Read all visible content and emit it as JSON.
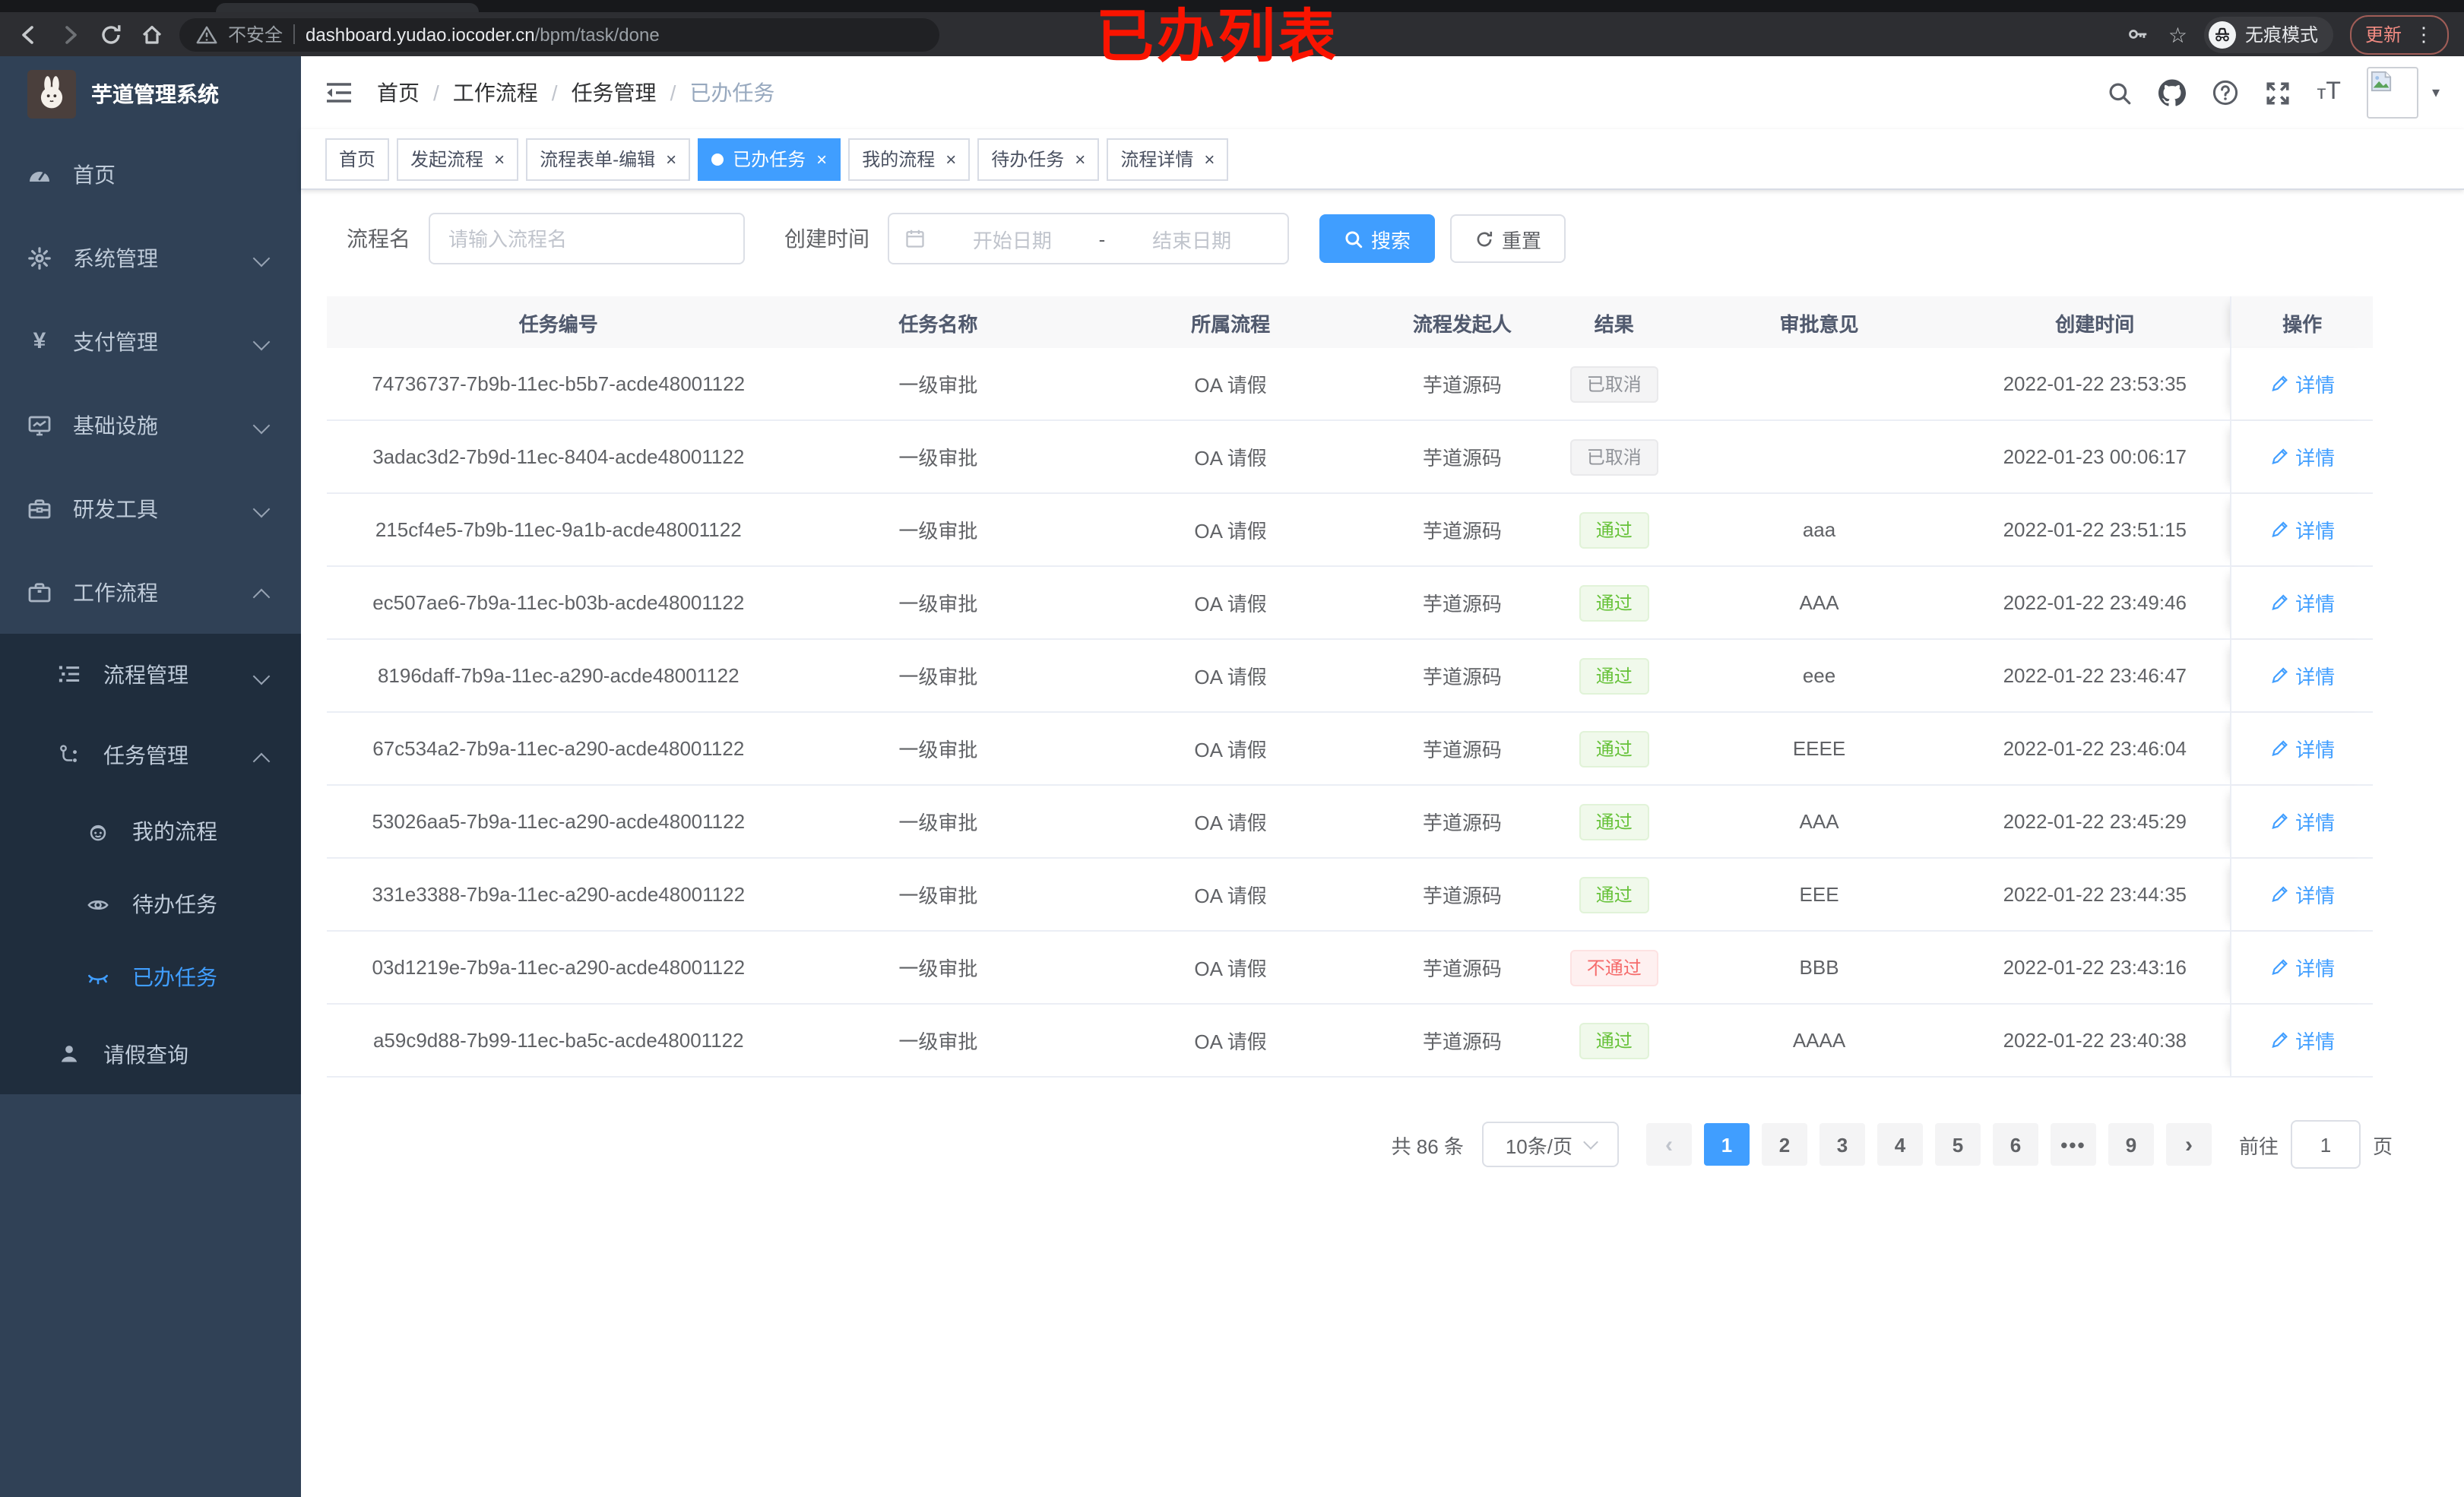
{
  "browser": {
    "security_label": "不安全",
    "url_host": "dashboard.yudao.iocoder.cn",
    "url_path": "/bpm/task/done",
    "incognito_label": "无痕模式",
    "update_label": "更新"
  },
  "overlay": {
    "annotation": "已办列表",
    "color": "#fa1400"
  },
  "ui": {
    "close_glyph": "×",
    "slash": "/",
    "caret": "▾",
    "star": "☆",
    "dots": "⋮",
    "prev": "‹",
    "next": "›",
    "font_icon": "тT"
  },
  "sidebar": {
    "app_title": "芋道管理系统",
    "items": [
      {
        "label": "首页"
      },
      {
        "label": "系统管理"
      },
      {
        "label": "支付管理"
      },
      {
        "label": "基础设施"
      },
      {
        "label": "研发工具"
      },
      {
        "label": "工作流程",
        "children": [
          {
            "label": "流程管理"
          },
          {
            "label": "任务管理",
            "children": [
              {
                "label": "我的流程"
              },
              {
                "label": "待办任务"
              },
              {
                "label": "已办任务"
              }
            ]
          },
          {
            "label": "请假查询"
          }
        ]
      }
    ]
  },
  "breadcrumb": [
    "首页",
    "工作流程",
    "任务管理",
    "已办任务"
  ],
  "tabs": [
    {
      "label": "首页"
    },
    {
      "label": "发起流程"
    },
    {
      "label": "流程表单-编辑"
    },
    {
      "label": "已办任务"
    },
    {
      "label": "我的流程"
    },
    {
      "label": "待办任务"
    },
    {
      "label": "流程详情"
    }
  ],
  "filters": {
    "name_label": "流程名",
    "name_placeholder": "请输入流程名",
    "date_label": "创建时间",
    "date_start_placeholder": "开始日期",
    "date_separator": "-",
    "date_end_placeholder": "结束日期",
    "search_label": "搜索",
    "reset_label": "重置"
  },
  "table": {
    "columns": [
      "任务编号",
      "任务名称",
      "所属流程",
      "流程发起人",
      "结果",
      "审批意见",
      "创建时间",
      "操作"
    ],
    "action_label": "详情",
    "rows": [
      {
        "id": "74736737-7b9b-11ec-b5b7-acde48001122",
        "name": "一级审批",
        "process": "OA 请假",
        "starter": "芋道源码",
        "result": "已取消",
        "result_type": "info",
        "comment": "",
        "created": "2022-01-22 23:53:35"
      },
      {
        "id": "3adac3d2-7b9d-11ec-8404-acde48001122",
        "name": "一级审批",
        "process": "OA 请假",
        "starter": "芋道源码",
        "result": "已取消",
        "result_type": "info",
        "comment": "",
        "created": "2022-01-23 00:06:17"
      },
      {
        "id": "215cf4e5-7b9b-11ec-9a1b-acde48001122",
        "name": "一级审批",
        "process": "OA 请假",
        "starter": "芋道源码",
        "result": "通过",
        "result_type": "success",
        "comment": "aaa",
        "created": "2022-01-22 23:51:15"
      },
      {
        "id": "ec507ae6-7b9a-11ec-b03b-acde48001122",
        "name": "一级审批",
        "process": "OA 请假",
        "starter": "芋道源码",
        "result": "通过",
        "result_type": "success",
        "comment": "AAA",
        "created": "2022-01-22 23:49:46"
      },
      {
        "id": "8196daff-7b9a-11ec-a290-acde48001122",
        "name": "一级审批",
        "process": "OA 请假",
        "starter": "芋道源码",
        "result": "通过",
        "result_type": "success",
        "comment": "eee",
        "created": "2022-01-22 23:46:47"
      },
      {
        "id": "67c534a2-7b9a-11ec-a290-acde48001122",
        "name": "一级审批",
        "process": "OA 请假",
        "starter": "芋道源码",
        "result": "通过",
        "result_type": "success",
        "comment": "EEEE",
        "created": "2022-01-22 23:46:04"
      },
      {
        "id": "53026aa5-7b9a-11ec-a290-acde48001122",
        "name": "一级审批",
        "process": "OA 请假",
        "starter": "芋道源码",
        "result": "通过",
        "result_type": "success",
        "comment": "AAA",
        "created": "2022-01-22 23:45:29"
      },
      {
        "id": "331e3388-7b9a-11ec-a290-acde48001122",
        "name": "一级审批",
        "process": "OA 请假",
        "starter": "芋道源码",
        "result": "通过",
        "result_type": "success",
        "comment": "EEE",
        "created": "2022-01-22 23:44:35"
      },
      {
        "id": "03d1219e-7b9a-11ec-a290-acde48001122",
        "name": "一级审批",
        "process": "OA 请假",
        "starter": "芋道源码",
        "result": "不通过",
        "result_type": "danger",
        "comment": "BBB",
        "created": "2022-01-22 23:43:16"
      },
      {
        "id": "a59c9d88-7b99-11ec-ba5c-acde48001122",
        "name": "一级审批",
        "process": "OA 请假",
        "starter": "芋道源码",
        "result": "通过",
        "result_type": "success",
        "comment": "AAAA",
        "created": "2022-01-22 23:40:38"
      }
    ]
  },
  "pagination": {
    "total_label": "共 86 条",
    "page_size_value": "10条/页",
    "pages": [
      {
        "t": "1",
        "cls": "active"
      },
      {
        "t": "2"
      },
      {
        "t": "3"
      },
      {
        "t": "4"
      },
      {
        "t": "5"
      },
      {
        "t": "6"
      },
      {
        "t": "•••",
        "cls": "ellipsis"
      },
      {
        "t": "9"
      }
    ],
    "goto_label": "前往",
    "goto_value": "1",
    "page_unit": "页"
  },
  "colors": {
    "accent": "#409eff",
    "success": "#67c23a",
    "danger": "#f56c6c",
    "info": "#909399",
    "sidebar_bg": "#304156",
    "submenu_bg": "#1f2d3d",
    "annotation_red": "#fa1400"
  }
}
